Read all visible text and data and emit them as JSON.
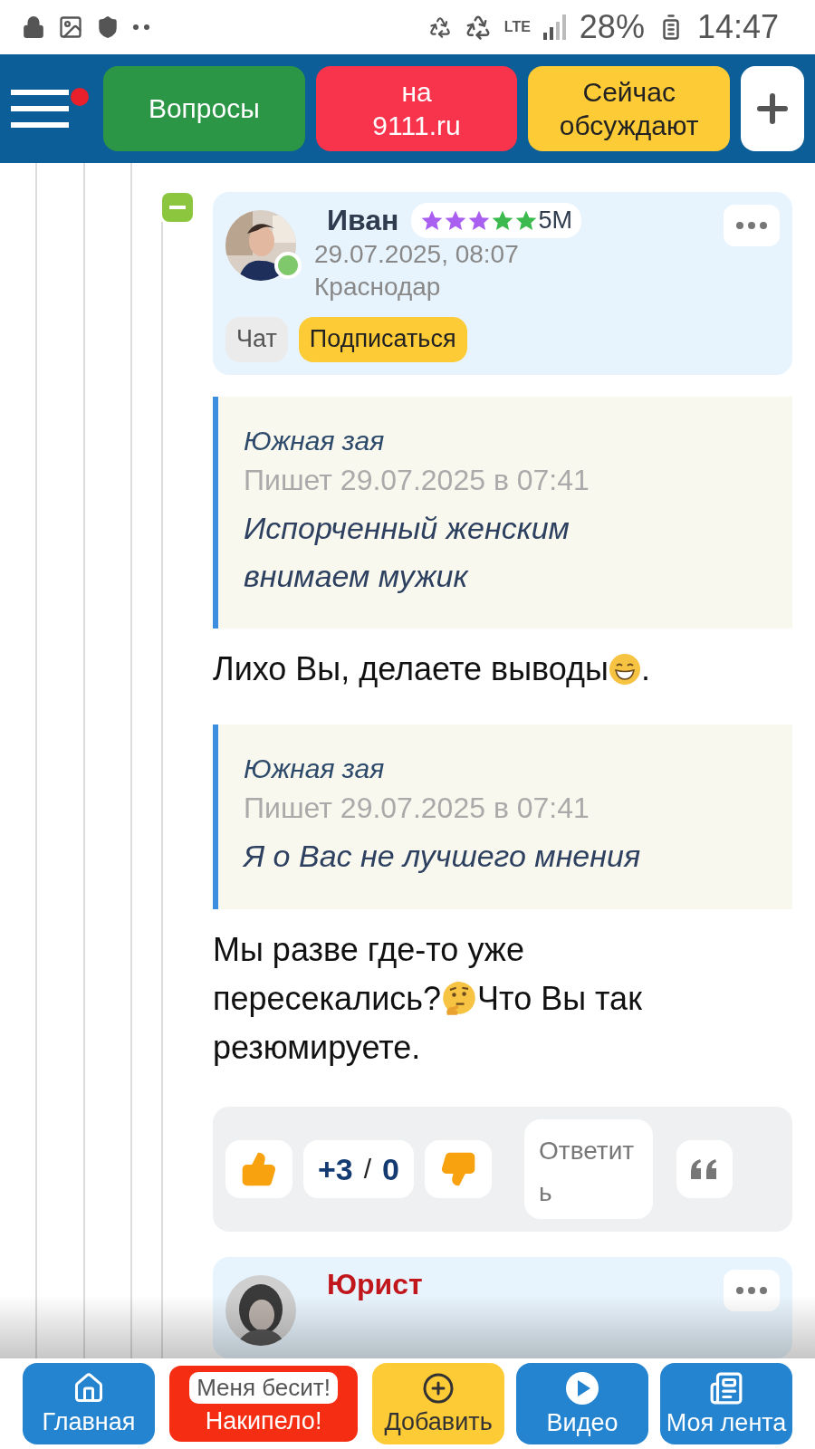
{
  "status_bar": {
    "network": "LTE",
    "battery": "28%",
    "time": "14:47"
  },
  "header": {
    "menu_badge": true,
    "buttons": [
      {
        "lines": [
          "Вопросы"
        ],
        "color": "#2a9646"
      },
      {
        "lines": [
          "на",
          "9111.ru"
        ],
        "color": "#f7344c"
      },
      {
        "lines": [
          "Сейчас",
          "обсуждают"
        ],
        "color": "#fdcb36"
      }
    ]
  },
  "comment": {
    "expanded": true,
    "author": "Иван",
    "online": true,
    "rank": "5M",
    "stars": [
      {
        "color": "#a95ff0"
      },
      {
        "color": "#a95ff0"
      },
      {
        "color": "#a95ff0"
      },
      {
        "color": "#3dba4e"
      },
      {
        "color": "#3dba4e"
      }
    ],
    "date": "29.07.2025, 08:07",
    "city": "Краснодар",
    "actions": [
      {
        "label": "Чат",
        "kind": "plain"
      },
      {
        "label": "Подписаться",
        "kind": "accent"
      }
    ],
    "body": [
      {
        "kind": "quote",
        "author": "Южная зая",
        "meta": "Пишет 29.07.2025 в 07:41",
        "text": "Испорченный женским внимаем мужик"
      },
      {
        "kind": "paragraph",
        "parts": [
          {
            "kind": "text",
            "text": "Лихо Вы, делаете выводы"
          },
          {
            "kind": "grin"
          },
          {
            "kind": "text",
            "text": "."
          }
        ]
      },
      {
        "kind": "quote",
        "author": "Южная зая",
        "meta": "Пишет 29.07.2025 в 07:41",
        "text": "Я о Вас не лучшего мнения"
      },
      {
        "kind": "paragraph",
        "parts": [
          {
            "kind": "text",
            "text": "Мы разве где-то уже пересекались?"
          },
          {
            "kind": "think"
          },
          {
            "kind": "text",
            "text": "Что Вы так резюмируете."
          }
        ]
      }
    ],
    "votes": {
      "plus": "+3",
      "separator": "/",
      "minus": "0"
    },
    "reply": "Ответить"
  },
  "next_comment": {
    "author": "Юрист"
  },
  "bottom_nav": [
    {
      "kind": "home",
      "label": "Главная"
    },
    {
      "kind": "rant",
      "badge": "Меня бесит!",
      "label": "Накипело!"
    },
    {
      "kind": "add",
      "label": "Добавить"
    },
    {
      "kind": "video",
      "label": "Видео"
    },
    {
      "kind": "feed",
      "label": "Моя лента"
    }
  ]
}
